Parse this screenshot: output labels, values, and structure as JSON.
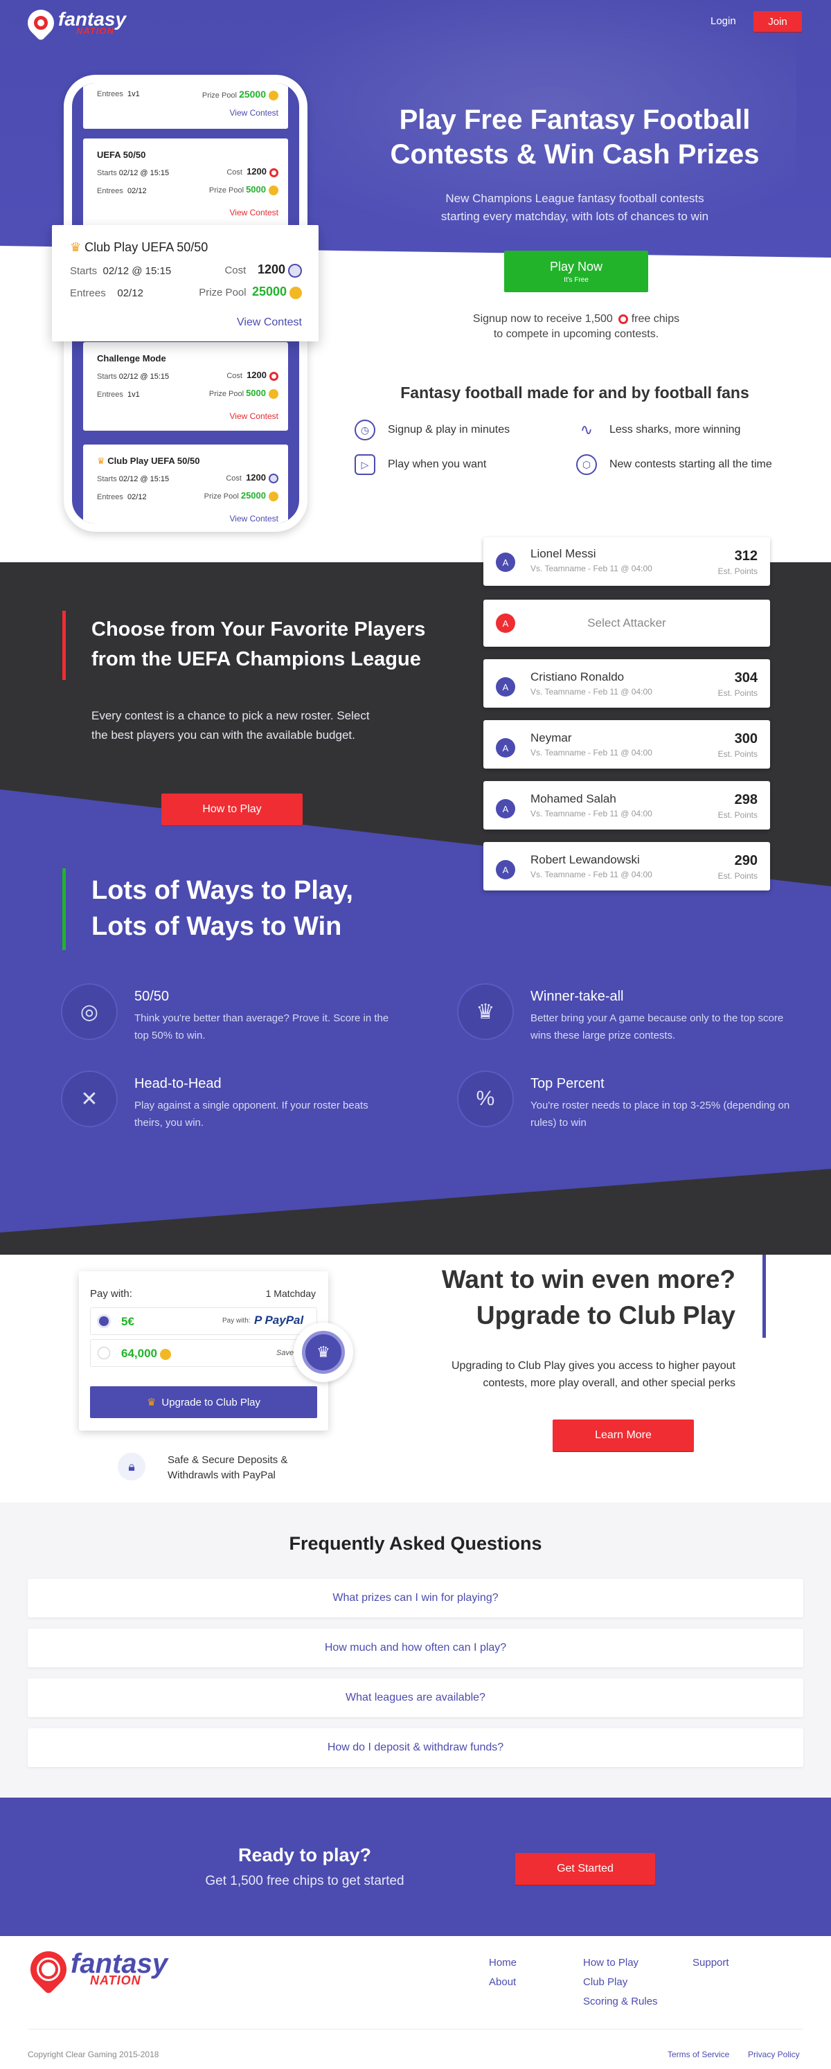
{
  "header": {
    "logo_word1": "fantasy",
    "logo_word2": "NATION",
    "login_label": "Login",
    "join_label": "Join"
  },
  "hero": {
    "title_line1": "Play Free Fantasy Football",
    "title_line2": "Contests & Win Cash Prizes",
    "subtitle_line1": "New Champions League fantasy football contests",
    "subtitle_line2": "starting every matchday, with lots of chances to win",
    "play_now_label": "Play Now",
    "play_now_sub": "It's Free",
    "signup_line1_a": "Signup now to receive 1,500",
    "signup_line1_b": "free chips",
    "signup_line2": "to compete in upcoming contests."
  },
  "phone": {
    "cards": [
      {
        "title": "",
        "entries_label": "Entrees",
        "entries": "1v1",
        "prize_label": "Prize Pool",
        "prize": "25000",
        "link": "View Contest"
      },
      {
        "title": "UEFA 50/50",
        "starts_label": "Starts",
        "starts": "02/12 @ 15:15",
        "cost_label": "Cost",
        "cost": "1200",
        "entries_label": "Entrees",
        "entries": "02/12",
        "prize_label": "Prize Pool",
        "prize": "5000",
        "link": "View Contest"
      },
      {
        "title": "Challenge Mode",
        "starts_label": "Starts",
        "starts": "02/12 @ 15:15",
        "cost_label": "Cost",
        "cost": "1200",
        "entries_label": "Entrees",
        "entries": "1v1",
        "prize_label": "Prize Pool",
        "prize": "5000",
        "link": "View Contest"
      },
      {
        "title": "Club Play UEFA 50/50",
        "starts_label": "Starts",
        "starts": "02/12 @ 15:15",
        "cost_label": "Cost",
        "cost": "1200",
        "entries_label": "Entrees",
        "entries": "02/12",
        "prize_label": "Prize Pool",
        "prize": "25000",
        "link": "View Contest"
      }
    ],
    "featured": {
      "title": "Club Play UEFA 50/50",
      "starts_label": "Starts",
      "starts": "02/12 @ 15:15",
      "cost_label": "Cost",
      "cost": "1200",
      "entries_label": "Entrees",
      "entries": "02/12",
      "prize_label": "Prize Pool",
      "prize": "25000",
      "link": "View Contest"
    }
  },
  "features": {
    "title": "Fantasy football made for and by football fans",
    "items": [
      {
        "icon": "clock-icon",
        "label": "Signup & play in minutes"
      },
      {
        "icon": "shark-icon",
        "label": "Less sharks, more winning"
      },
      {
        "icon": "play-icon",
        "label": "Play when you want"
      },
      {
        "icon": "ball-icon",
        "label": "New contests starting all the time"
      }
    ]
  },
  "players_section": {
    "title_line1": "Choose from Your Favorite Players",
    "title_line2": "from the UEFA Champions League",
    "desc_line1": "Every contest is a chance to pick a new roster. Select",
    "desc_line2": "the best players you can with the available budget.",
    "button": "How to Play",
    "select_label": "Select Attacker",
    "avatar_letter": "A",
    "points_label": "Est. Points",
    "players": [
      {
        "name": "Lionel Messi",
        "sub": "Vs. Teamname - Feb 11 @ 04:00",
        "points": "312"
      },
      {
        "name": "Cristiano Ronaldo",
        "sub": "Vs. Teamname - Feb 11 @ 04:00",
        "points": "304"
      },
      {
        "name": "Neymar",
        "sub": "Vs. Teamname - Feb 11 @ 04:00",
        "points": "300"
      },
      {
        "name": "Mohamed Salah",
        "sub": "Vs. Teamname - Feb 11 @ 04:00",
        "points": "298"
      },
      {
        "name": "Robert Lewandowski",
        "sub": "Vs. Teamname - Feb 11 @ 04:00",
        "points": "290"
      }
    ]
  },
  "ways": {
    "title_line1": "Lots of Ways to Play,",
    "title_line2": "Lots of Ways to Win",
    "items": [
      {
        "icon": "fifty-fifty-icon",
        "title": "50/50",
        "desc": "Think you're better than average? Prove it. Score in the top 50% to win."
      },
      {
        "icon": "crown-trophy-icon",
        "title": "Winner-take-all",
        "desc": "Better bring your A game because only to the top score wins these large prize contests."
      },
      {
        "icon": "crossed-swords-icon",
        "title": "Head-to-Head",
        "desc": "Play against a single opponent. If your roster beats theirs, you win."
      },
      {
        "icon": "percent-icon",
        "title": "Top Percent",
        "desc": "You're roster needs to place in top 3-25% (depending on rules) to win"
      }
    ]
  },
  "club_play": {
    "pay_with": "Pay with:",
    "matchday": "1 Matchday",
    "option1_price": "5€",
    "option1_pay": "Pay with:",
    "paypal": "PayPal",
    "option2_price": "64,000",
    "option2_save": "Save 1",
    "upgrade_button": "Upgrade to Club Play",
    "secure_line1": "Safe & Secure Deposits &",
    "secure_line2": "Withdrawls with PayPal",
    "title_line1": "Want to win even more?",
    "title_line2": "Upgrade to Club Play",
    "desc_line1": "Upgrading to Club Play gives you access to higher payout",
    "desc_line2": "contests, more play overall, and other special perks",
    "learn_more": "Learn More"
  },
  "faq": {
    "title": "Frequently Asked Questions",
    "items": [
      "What prizes can I win for playing?",
      "How much and how often can I play?",
      "What leagues are available?",
      "How do I deposit & withdraw funds?"
    ]
  },
  "cta": {
    "title": "Ready to play?",
    "subtitle": "Get 1,500 free chips to get started",
    "button": "Get Started"
  },
  "footer": {
    "logo_word1": "fantasy",
    "logo_word2": "NATION",
    "col1": [
      "Home",
      "About"
    ],
    "col2": [
      "How to Play",
      "Club Play",
      "Scoring & Rules"
    ],
    "col3": [
      "Support"
    ],
    "copyright": "Copyright Clear Gaming 2015-2018",
    "terms": "Terms of Service",
    "privacy": "Privacy Policy"
  },
  "colors": {
    "brand_purple": "#4b4bb0",
    "brand_red": "#ef2d32",
    "green": "#22b32b",
    "dark": "#333336"
  }
}
